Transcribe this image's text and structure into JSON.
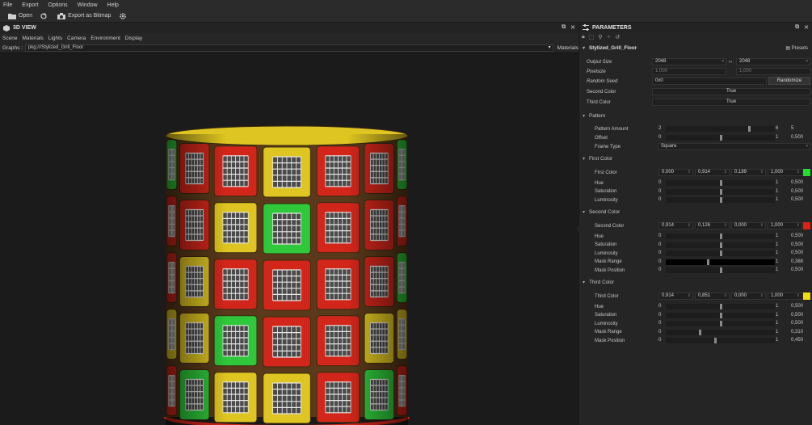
{
  "menu": [
    "File",
    "Export",
    "Options",
    "Window",
    "Help"
  ],
  "toolbar": {
    "open": "Open",
    "export": "Export as Bitmap"
  },
  "view3d": {
    "title": "3D VIEW",
    "menu": [
      "Scene",
      "Materials",
      "Lights",
      "Camera",
      "Environment",
      "Display"
    ],
    "graph_label": "Graphs :",
    "graph_value": "pkg:///Stylized_Grill_Floor",
    "materials_label": "Materials"
  },
  "params": {
    "title": "PARAMETERS",
    "graph_name": "Stylized_Grill_Floor",
    "presets": "Presets",
    "output_size": {
      "label": "Output Size",
      "w": "2048",
      "h": "2048"
    },
    "pixelsize": {
      "label": "Pixelsize",
      "a": "1,000",
      "b": "1,000"
    },
    "random_seed": {
      "label": "Random Seed",
      "value": "0x0",
      "button": "Randomize"
    },
    "second_color_toggle": {
      "label": "Second Color",
      "value": "True"
    },
    "third_color_toggle": {
      "label": "Third Color",
      "value": "True"
    },
    "pattern": {
      "section": "Pattern",
      "amount": {
        "label": "Pattern Amount",
        "min": "2",
        "max": "6",
        "value": "5",
        "pos": 0.75
      },
      "offset": {
        "label": "Offset",
        "min": "0",
        "max": "1",
        "value": "0,500",
        "pos": 0.5
      },
      "frame": {
        "label": "Frame Type",
        "value": "Square"
      }
    },
    "first": {
      "section": "First Color",
      "label": "First Color",
      "rgba": [
        "0,000",
        "0,914",
        "0,189",
        "1,000"
      ],
      "swatch": "#1fe02c",
      "rows": [
        {
          "label": "Hue",
          "min": "0",
          "max": "1",
          "value": "0,500",
          "pos": 0.5
        },
        {
          "label": "Saturation",
          "min": "0",
          "max": "1",
          "value": "0,500",
          "pos": 0.5
        },
        {
          "label": "Luminosity",
          "min": "0",
          "max": "1",
          "value": "0,500",
          "pos": 0.5
        }
      ]
    },
    "second": {
      "section": "Second Color",
      "label": "Second Color",
      "rgba": [
        "0,914",
        "0,126",
        "0,000",
        "1,000"
      ],
      "swatch": "#e02010",
      "rows": [
        {
          "label": "Hue",
          "min": "0",
          "max": "1",
          "value": "0,500",
          "pos": 0.5
        },
        {
          "label": "Saturation",
          "min": "0",
          "max": "1",
          "value": "0,500",
          "pos": 0.5
        },
        {
          "label": "Luminosity",
          "min": "0",
          "max": "1",
          "value": "0,500",
          "pos": 0.5
        },
        {
          "label": "Mask Range",
          "min": "0",
          "max": "1",
          "value": "0,388",
          "pos": 0.388
        },
        {
          "label": "Mask Position",
          "min": "0",
          "max": "1",
          "value": "0,500",
          "pos": 0.5
        }
      ]
    },
    "third": {
      "section": "Third Color",
      "label": "Third Color",
      "rgba": [
        "0,914",
        "0,851",
        "0,000",
        "1,000"
      ],
      "swatch": "#f0dd10",
      "rows": [
        {
          "label": "Hue",
          "min": "0",
          "max": "1",
          "value": "0,500",
          "pos": 0.5
        },
        {
          "label": "Saturation",
          "min": "0",
          "max": "1",
          "value": "0,500",
          "pos": 0.5
        },
        {
          "label": "Luminosity",
          "min": "0",
          "max": "1",
          "value": "0,500",
          "pos": 0.5
        },
        {
          "label": "Mask Range",
          "min": "0",
          "max": "1",
          "value": "0,310",
          "pos": 0.31
        },
        {
          "label": "Mask Position",
          "min": "0",
          "max": "1",
          "value": "0,450",
          "pos": 0.45
        }
      ]
    }
  },
  "colors": {
    "red": "#d2261a",
    "yellow": "#dfc521",
    "green": "#2ec83a",
    "grill": "#e8e8e8"
  }
}
